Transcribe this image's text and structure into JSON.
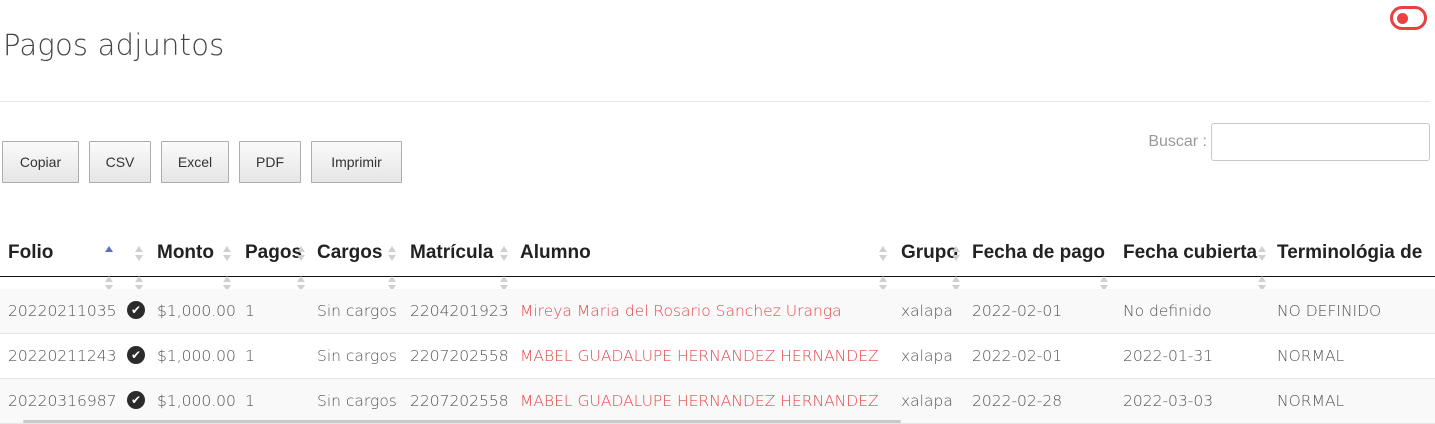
{
  "page": {
    "title": "Pagos adjuntos"
  },
  "toolbar": {
    "buttons": [
      {
        "label": "Copiar"
      },
      {
        "label": "CSV"
      },
      {
        "label": "Excel"
      },
      {
        "label": "PDF"
      },
      {
        "label": "Imprimir"
      }
    ]
  },
  "search": {
    "label": "Buscar :",
    "value": "",
    "placeholder": ""
  },
  "table": {
    "columns": [
      "Folio",
      "",
      "Monto",
      "Pagos",
      "Cargos",
      "Matrícula",
      "Alumno",
      "Grupo",
      "Fecha de pago",
      "Fecha cubierta",
      "Terminológia de"
    ],
    "rows": [
      {
        "folio": "20220211035",
        "status_icon": "check-circle-icon",
        "monto": "$1,000.00",
        "pagos": "1",
        "cargos": "Sin cargos",
        "matricula": "2204201923",
        "alumno": "Mireya Maria del Rosario Sanchez Uranga",
        "grupo": "xalapa",
        "fecha_pago": "2022-02-01",
        "fecha_cubierta": "No definido",
        "terminologia": "NO DEFINIDO"
      },
      {
        "folio": "20220211243",
        "status_icon": "check-circle-icon",
        "monto": "$1,000.00",
        "pagos": "1",
        "cargos": "Sin cargos",
        "matricula": "2207202558",
        "alumno": "MABEL GUADALUPE HERNANDEZ HERNANDEZ",
        "grupo": "xalapa",
        "fecha_pago": "2022-02-01",
        "fecha_cubierta": "2022-01-31",
        "terminologia": "NORMAL"
      },
      {
        "folio": "20220316987",
        "status_icon": "check-circle-icon",
        "monto": "$1,000.00",
        "pagos": "1",
        "cargos": "Sin cargos",
        "matricula": "2207202558",
        "alumno": "MABEL GUADALUPE HERNANDEZ HERNANDEZ",
        "grupo": "xalapa",
        "fecha_pago": "2022-02-28",
        "fecha_cubierta": "2022-03-03",
        "terminologia": "NORMAL"
      }
    ]
  },
  "colors": {
    "accent": "#e5474a",
    "toggle": "#e8413f",
    "sort_active": "#5a6fc0"
  }
}
